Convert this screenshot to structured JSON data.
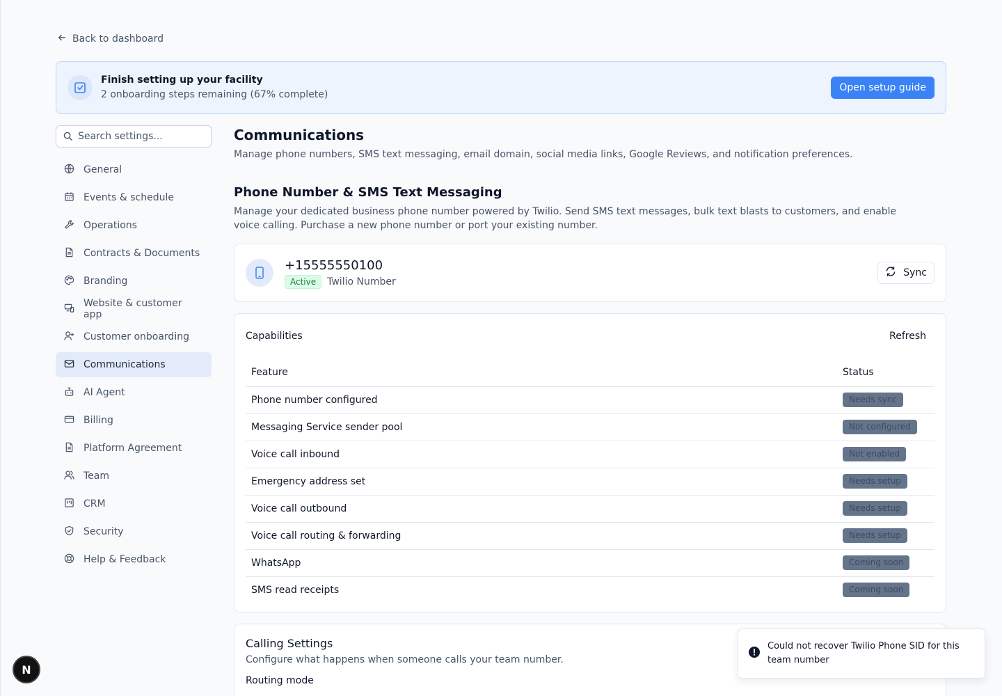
{
  "back_link": {
    "label": "Back to dashboard"
  },
  "setup_banner": {
    "title": "Finish setting up your facility",
    "subtitle": "2 onboarding steps remaining (67% complete)",
    "button_label": "Open setup guide"
  },
  "search": {
    "placeholder": "Search settings..."
  },
  "sidebar": {
    "items": [
      {
        "label": "General",
        "icon": "globe-icon"
      },
      {
        "label": "Events & schedule",
        "icon": "calendar-icon"
      },
      {
        "label": "Operations",
        "icon": "wrench-icon"
      },
      {
        "label": "Contracts & Documents",
        "icon": "document-icon"
      },
      {
        "label": "Branding",
        "icon": "palette-icon"
      },
      {
        "label": "Website & customer app",
        "icon": "devices-icon"
      },
      {
        "label": "Customer onboarding",
        "icon": "user-plus-icon"
      },
      {
        "label": "Communications",
        "icon": "mail-icon",
        "active": true
      },
      {
        "label": "AI Agent",
        "icon": "bot-icon"
      },
      {
        "label": "Billing",
        "icon": "credit-card-icon"
      },
      {
        "label": "Platform Agreement",
        "icon": "document-icon"
      },
      {
        "label": "Team",
        "icon": "users-icon"
      },
      {
        "label": "CRM",
        "icon": "crm-icon"
      },
      {
        "label": "Security",
        "icon": "shield-check-icon"
      },
      {
        "label": "Help & Feedback",
        "icon": "lifebuoy-icon"
      }
    ]
  },
  "main": {
    "title": "Communications",
    "description": "Manage phone numbers, SMS text messaging, email domain, social media links, Google Reviews, and notification preferences.",
    "section_title": "Phone Number & SMS Text Messaging",
    "section_description": "Manage your dedicated business phone number powered by Twilio. Send SMS text messages, bulk text blasts to customers, and enable voice calling. Purchase a new phone number or port your existing number."
  },
  "phone_card": {
    "number": "+15555550100",
    "status": "Active",
    "type": "Twilio Number",
    "sync_label": "Sync"
  },
  "capabilities": {
    "title": "Capabilities",
    "refresh_label": "Refresh",
    "columns": [
      "Feature",
      "Status"
    ],
    "rows": [
      {
        "feature": "Phone number configured",
        "status": "Needs sync"
      },
      {
        "feature": "Messaging Service sender pool",
        "status": "Not configured"
      },
      {
        "feature": "Voice call inbound",
        "status": "Not enabled"
      },
      {
        "feature": "Emergency address set",
        "status": "Needs setup"
      },
      {
        "feature": "Voice call outbound",
        "status": "Needs setup"
      },
      {
        "feature": "Voice call routing & forwarding",
        "status": "Needs setup"
      },
      {
        "feature": "WhatsApp",
        "status": "Coming soon"
      },
      {
        "feature": "SMS read receipts",
        "status": "Coming soon"
      }
    ]
  },
  "calling_settings": {
    "title": "Calling Settings",
    "description": "Configure what happens when someone calls your team number.",
    "routing_label": "Routing mode"
  },
  "toast": {
    "message": "Could not recover Twilio Phone SID for this team number"
  },
  "dev_badge": {
    "label": "N"
  },
  "colors": {
    "accent": "#3b82f6",
    "active_nav_bg": "#e3ebfb",
    "badge_bg": "#64748b",
    "success": "#15803d"
  }
}
